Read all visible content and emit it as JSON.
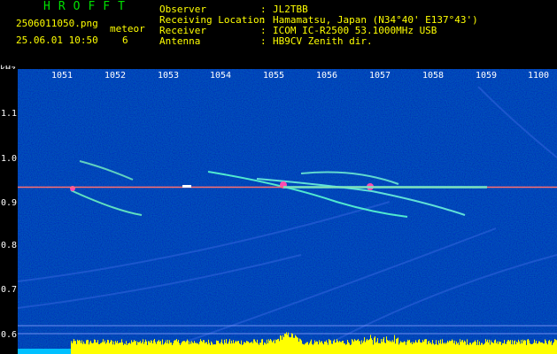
{
  "header": {
    "app_title": "HROFFT",
    "filename": "2506011050.png",
    "timestamp": "25.06.01 10:50",
    "meteor_label": "meteor",
    "meteor_count": "6",
    "fields": [
      {
        "label": "Observer",
        "sep": ":",
        "value": "JL2TBB"
      },
      {
        "label": "Receiving Location",
        "sep": ":",
        "value": "Hamamatsu, Japan (N34°40' E137°43')"
      },
      {
        "label": "Receiver",
        "sep": ":",
        "value": "ICOM IC-R2500 53.1000MHz USB"
      },
      {
        "label": "Antenna",
        "sep": ":",
        "value": "HB9CV Zenith dir."
      }
    ]
  },
  "axes": {
    "y_unit": "kHz",
    "x_ticks": [
      "1051",
      "1052",
      "1053",
      "1054",
      "1055",
      "1056",
      "1057",
      "1058",
      "1059",
      "1100"
    ],
    "y_ticks": [
      "1.1",
      "1.0",
      "0.9",
      "0.8",
      "0.7",
      "0.6"
    ]
  },
  "colors": {
    "header_green": "#00e000",
    "header_yellow": "#ffff00",
    "background_noise": "#00006e",
    "carrier_line": "#ff6a6a",
    "bottom_level": "#ffff00",
    "bottom_level_left": "#00c0ff"
  }
}
